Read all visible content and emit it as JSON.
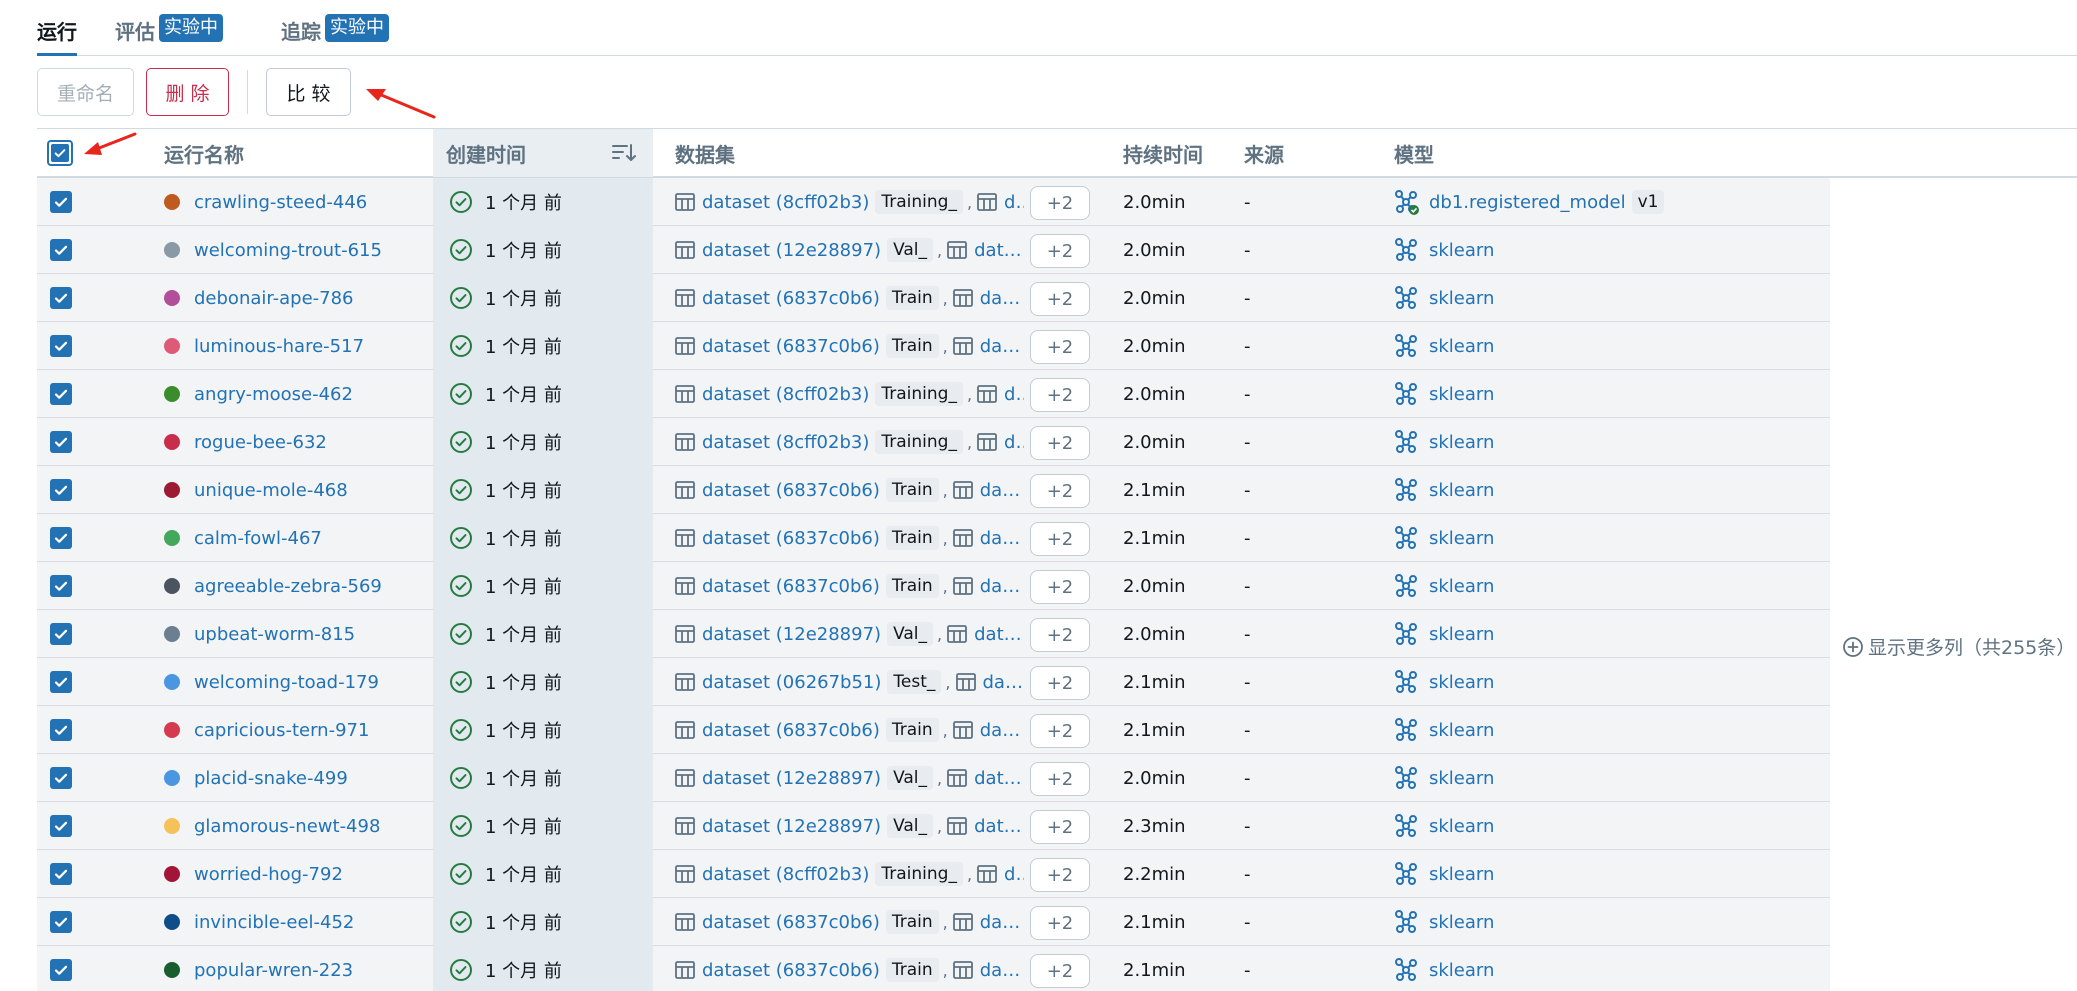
{
  "tabs": [
    {
      "label": "运行",
      "active": true
    },
    {
      "label": "评估",
      "badge": "实验中"
    },
    {
      "label": "追踪",
      "badge": "实验中"
    }
  ],
  "toolbar": {
    "rename": "重命名",
    "delete": "删 除",
    "compare": "比 较"
  },
  "columns": {
    "run_name": "运行名称",
    "created": "创建时间",
    "dataset": "数据集",
    "duration": "持续时间",
    "source": "来源",
    "model": "模型"
  },
  "more_columns": "显示更多列（共255条）",
  "colors": {
    "accent": "#2272b4",
    "success": "#277c43",
    "danger": "#c82d4c",
    "annotation_arrow": "#e8261c"
  },
  "rows": [
    {
      "name": "crawling-steed-446",
      "color": "#bf5b1e",
      "created": "1 个月 前",
      "dataset": "dataset (8cff02b3)",
      "tag": "Training_",
      "second": "da…",
      "more": "+2",
      "duration": "2.0min",
      "source": "-",
      "model": "db1.registered_model",
      "version": "v1",
      "registered": true
    },
    {
      "name": "welcoming-trout-615",
      "color": "#8a99a6",
      "created": "1 个月 前",
      "dataset": "dataset (12e28897)",
      "tag": "Val_",
      "second": "datas…",
      "more": "+2",
      "duration": "2.0min",
      "source": "-",
      "model": "sklearn"
    },
    {
      "name": "debonair-ape-786",
      "color": "#b34f9a",
      "created": "1 个月 前",
      "dataset": "dataset (6837c0b6)",
      "tag": "Train",
      "second": "data…",
      "more": "+2",
      "duration": "2.0min",
      "source": "-",
      "model": "sklearn"
    },
    {
      "name": "luminous-hare-517",
      "color": "#de5a76",
      "created": "1 个月 前",
      "dataset": "dataset (6837c0b6)",
      "tag": "Train",
      "second": "data…",
      "more": "+2",
      "duration": "2.0min",
      "source": "-",
      "model": "sklearn"
    },
    {
      "name": "angry-moose-462",
      "color": "#3b8c2a",
      "created": "1 个月 前",
      "dataset": "dataset (8cff02b3)",
      "tag": "Training_",
      "second": "da…",
      "more": "+2",
      "duration": "2.0min",
      "source": "-",
      "model": "sklearn"
    },
    {
      "name": "rogue-bee-632",
      "color": "#c82d4c",
      "created": "1 个月 前",
      "dataset": "dataset (8cff02b3)",
      "tag": "Training_",
      "second": "da…",
      "more": "+2",
      "duration": "2.0min",
      "source": "-",
      "model": "sklearn"
    },
    {
      "name": "unique-mole-468",
      "color": "#9d1934",
      "created": "1 个月 前",
      "dataset": "dataset (6837c0b6)",
      "tag": "Train",
      "second": "data…",
      "more": "+2",
      "duration": "2.1min",
      "source": "-",
      "model": "sklearn"
    },
    {
      "name": "calm-fowl-467",
      "color": "#41a85c",
      "created": "1 个月 前",
      "dataset": "dataset (6837c0b6)",
      "tag": "Train",
      "second": "data…",
      "more": "+2",
      "duration": "2.1min",
      "source": "-",
      "model": "sklearn"
    },
    {
      "name": "agreeable-zebra-569",
      "color": "#4a5561",
      "created": "1 个月 前",
      "dataset": "dataset (6837c0b6)",
      "tag": "Train",
      "second": "data…",
      "more": "+2",
      "duration": "2.0min",
      "source": "-",
      "model": "sklearn"
    },
    {
      "name": "upbeat-worm-815",
      "color": "#6b7f91",
      "created": "1 个月 前",
      "dataset": "dataset (12e28897)",
      "tag": "Val_",
      "second": "datas…",
      "more": "+2",
      "duration": "2.0min",
      "source": "-",
      "model": "sklearn"
    },
    {
      "name": "welcoming-toad-179",
      "color": "#4a96e0",
      "created": "1 个月 前",
      "dataset": "dataset (06267b51)",
      "tag": "Test_",
      "second": "data…",
      "more": "+2",
      "duration": "2.1min",
      "source": "-",
      "model": "sklearn"
    },
    {
      "name": "capricious-tern-971",
      "color": "#d63a4e",
      "created": "1 个月 前",
      "dataset": "dataset (6837c0b6)",
      "tag": "Train",
      "second": "data…",
      "more": "+2",
      "duration": "2.1min",
      "source": "-",
      "model": "sklearn"
    },
    {
      "name": "placid-snake-499",
      "color": "#4a96e0",
      "created": "1 个月 前",
      "dataset": "dataset (12e28897)",
      "tag": "Val_",
      "second": "datas…",
      "more": "+2",
      "duration": "2.0min",
      "source": "-",
      "model": "sklearn"
    },
    {
      "name": "glamorous-newt-498",
      "color": "#f5c25a",
      "created": "1 个月 前",
      "dataset": "dataset (12e28897)",
      "tag": "Val_",
      "second": "datas…",
      "more": "+2",
      "duration": "2.3min",
      "source": "-",
      "model": "sklearn"
    },
    {
      "name": "worried-hog-792",
      "color": "#a31536",
      "created": "1 个月 前",
      "dataset": "dataset (8cff02b3)",
      "tag": "Training_",
      "second": "da…",
      "more": "+2",
      "duration": "2.2min",
      "source": "-",
      "model": "sklearn"
    },
    {
      "name": "invincible-eel-452",
      "color": "#0f4d8a",
      "created": "1 个月 前",
      "dataset": "dataset (6837c0b6)",
      "tag": "Train",
      "second": "data…",
      "more": "+2",
      "duration": "2.1min",
      "source": "-",
      "model": "sklearn"
    },
    {
      "name": "popular-wren-223",
      "color": "#1a5e2f",
      "created": "1 个月 前",
      "dataset": "dataset (6837c0b6)",
      "tag": "Train",
      "second": "data…",
      "more": "+2",
      "duration": "2.1min",
      "source": "-",
      "model": "sklearn"
    }
  ]
}
